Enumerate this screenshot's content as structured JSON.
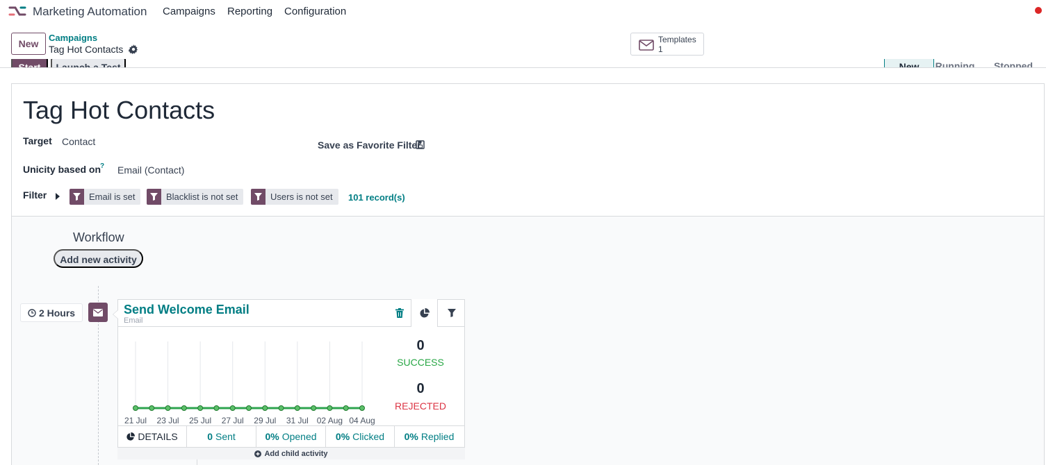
{
  "app": {
    "name": "Marketing Automation"
  },
  "menu": [
    "Campaigns",
    "Reporting",
    "Configuration"
  ],
  "control_panel": {
    "new_label": "New",
    "breadcrumb_parent": "Campaigns",
    "breadcrumb_current": "Tag Hot Contacts",
    "templates": {
      "label": "Templates",
      "count": "1"
    }
  },
  "status_bar": {
    "start_label": "Start",
    "launch_label": "Launch a Test",
    "stages": [
      "New",
      "Running",
      "Stopped"
    ],
    "active_stage": "New"
  },
  "form": {
    "title": "Tag Hot Contacts",
    "target_label": "Target",
    "target_value": "Contact",
    "unicity_label": "Unicity based on",
    "unicity_help": "?",
    "unicity_value": "Email (Contact)",
    "save_favorite": "Save as Favorite Filter",
    "filter_label": "Filter",
    "filters": [
      "Email is set",
      "Blacklist is not set",
      "Users is not set"
    ],
    "records": "101 record(s)"
  },
  "workflow": {
    "title": "Workflow",
    "add_activity": "Add new activity",
    "activity": {
      "interval": "2 Hours",
      "name": "Send Welcome Email",
      "type": "Email",
      "success_count": "0",
      "success_label": "SUCCESS",
      "rejected_count": "0",
      "rejected_label": "REJECTED",
      "details_label": "DETAILS",
      "sent": {
        "value": "0",
        "label": "Sent"
      },
      "opened": {
        "value": "0%",
        "label": "Opened"
      },
      "clicked": {
        "value": "0%",
        "label": "Clicked"
      },
      "replied": {
        "value": "0%",
        "label": "Replied"
      },
      "add_child": "Add child activity"
    }
  },
  "colors": {
    "brand": "#714b67",
    "teal": "#017e84",
    "success": "#28a745",
    "danger": "#dc3545",
    "line": "#2ea44f"
  },
  "chart_data": {
    "type": "line",
    "x": [
      "21 Jul",
      "22 Jul",
      "23 Jul",
      "24 Jul",
      "25 Jul",
      "26 Jul",
      "27 Jul",
      "28 Jul",
      "29 Jul",
      "30 Jul",
      "31 Jul",
      "01 Aug",
      "02 Aug",
      "03 Aug",
      "04 Aug"
    ],
    "x_tick_labels": [
      "21 Jul",
      "23 Jul",
      "25 Jul",
      "27 Jul",
      "29 Jul",
      "31 Jul",
      "02 Aug",
      "04 Aug"
    ],
    "series": [
      {
        "values": [
          0,
          0,
          0,
          0,
          0,
          0,
          0,
          0,
          0,
          0,
          0,
          0,
          0,
          0,
          0
        ]
      }
    ],
    "grid": true
  }
}
